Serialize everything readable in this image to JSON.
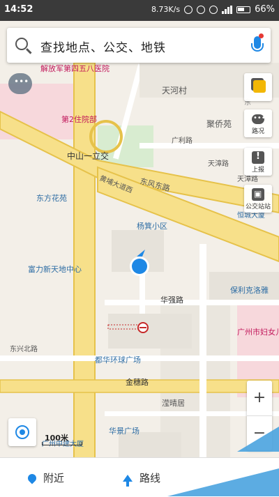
{
  "status_bar": {
    "time": "14:52",
    "net_speed": "8.73K/s",
    "battery": "66%"
  },
  "search": {
    "placeholder": "查找地点、公交、地铁"
  },
  "side_buttons": {
    "layers": "",
    "traffic": "路况",
    "report": "上报",
    "bus_stop": "公交站站"
  },
  "zoom": {
    "in": "+",
    "out": "−"
  },
  "scale": {
    "label": "100米"
  },
  "bottom_bar": {
    "nearby": "附近",
    "route": "路线"
  },
  "map_labels": {
    "hospital": "解放军第四五八医院",
    "hospital_2": "第2住院部",
    "top_road": "东",
    "tianhe_village": "天河村",
    "juqiao": "聚侨苑",
    "guangli_road": "广利路",
    "zhongshan_yili": "中山一立交",
    "dongfeng_east": "东风东路",
    "dongfang_garden": "东方花苑",
    "huangpu_avenue": "黄埔大道西",
    "tianzhang_road_1": "天漳路",
    "tianzhang_road_2": "天漳路",
    "hengcheng": "恒城大厦",
    "jiaji_xiaoqu": "杨箕小区",
    "fuli_xintiandi": "富力新天地中心",
    "huajiang_road": "华强路",
    "baoli_kepu": "保利克洛雅",
    "guangzhou_hospital": "广州市妇女儿童医疗中心",
    "dongxing_north": "东兴北路",
    "huanqiu_square": "都华环球广场",
    "jinsui_road": "金穗路",
    "guangda": "广州中建大厦",
    "huajing_square": "华景广场",
    "yingqing": "滢晴居"
  }
}
